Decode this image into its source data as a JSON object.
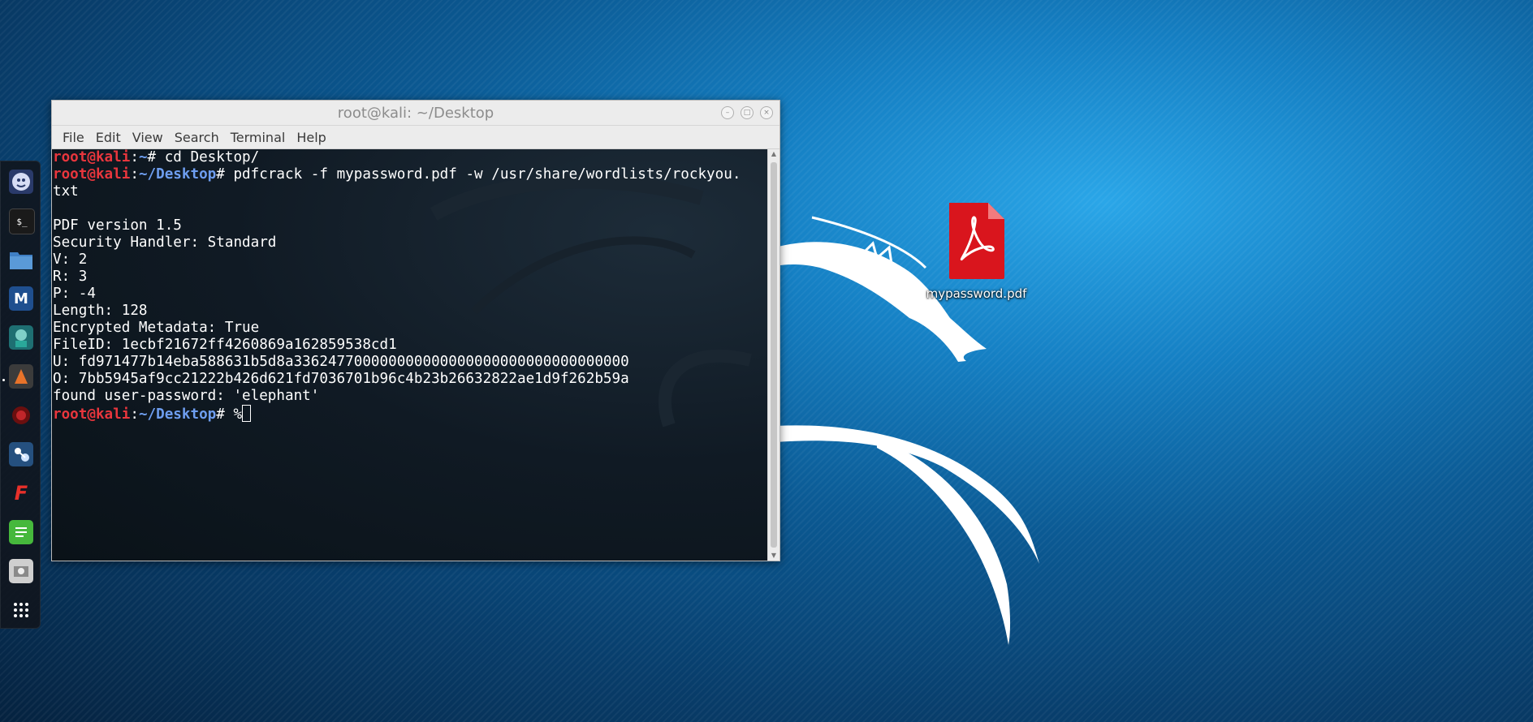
{
  "window": {
    "title": "root@kali: ~/Desktop",
    "controls": [
      "–",
      "□",
      "×"
    ]
  },
  "menubar": {
    "items": [
      "File",
      "Edit",
      "View",
      "Search",
      "Terminal",
      "Help"
    ]
  },
  "terminal": {
    "prompt_user": "root@kali",
    "prompt_home": "~",
    "prompt_desktop": "~/Desktop",
    "prompt_symbol": "# ",
    "cmd1": "cd Desktop/",
    "cmd2": "pdfcrack -f mypassword.pdf -w /usr/share/wordlists/rockyou.",
    "cmd2_wrap": "txt",
    "output": [
      "",
      "PDF version 1.5",
      "Security Handler: Standard",
      "V: 2",
      "R: 3",
      "P: -4",
      "Length: 128",
      "Encrypted Metadata: True",
      "FileID: 1ecbf21672ff4260869a162859538cd1",
      "U: fd971477b14eba588631b5d8a336247700000000000000000000000000000000",
      "O: 7bb5945af9cc21222b426d621fd7036701b96c4b23b26632822ae1d9f262b59a",
      "found user-password: 'elephant'"
    ],
    "last_input": "%"
  },
  "desktop": {
    "file_icon": "pdf-file-icon",
    "file_label": "mypassword.pdf"
  },
  "dock": {
    "items": [
      "kali-menu-icon",
      "terminal-icon",
      "files-icon",
      "metasploit-icon",
      "armitage-icon",
      "burpsuite-icon",
      "beef-icon",
      "maltego-icon",
      "faraday-icon",
      "leafpad-icon",
      "cutycapt-icon",
      "show-apps-icon"
    ]
  },
  "colors": {
    "prompt_user": "#e8363d",
    "prompt_path": "#6e9ef0",
    "pdf_red": "#d9151d"
  }
}
